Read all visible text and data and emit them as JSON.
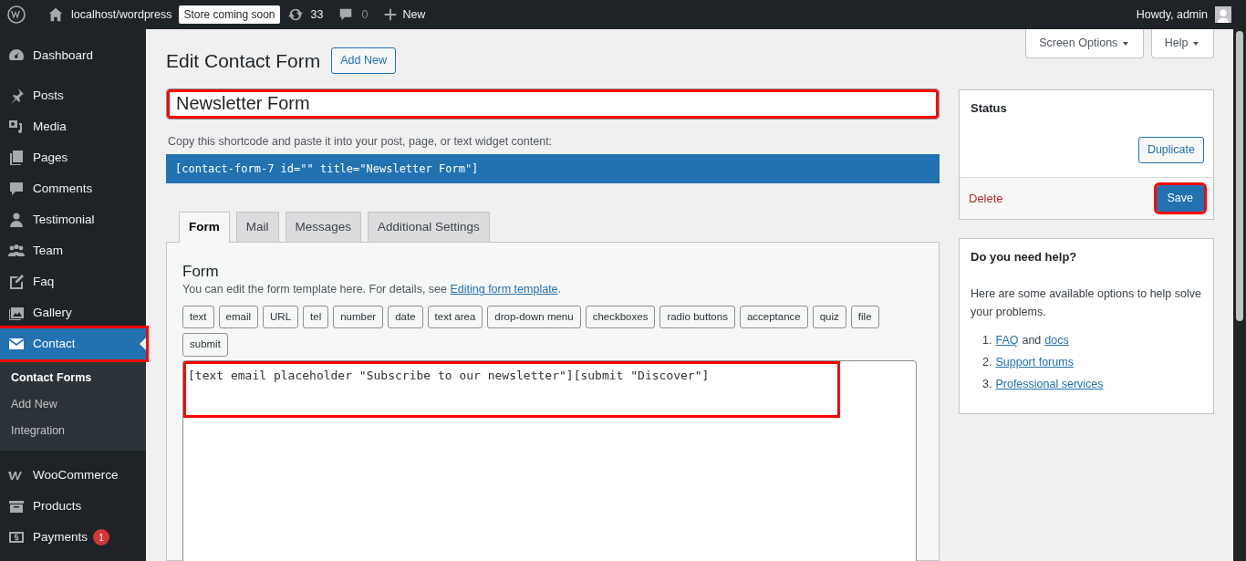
{
  "admin_bar": {
    "site": "localhost/wordpress",
    "store_badge": "Store coming soon",
    "updates": "33",
    "comments": "0",
    "new": "New",
    "greeting": "Howdy, admin"
  },
  "sidebar": {
    "items": [
      {
        "label": "Dashboard",
        "selected": false
      },
      {
        "label": "Posts",
        "selected": false
      },
      {
        "label": "Media",
        "selected": false
      },
      {
        "label": "Pages",
        "selected": false
      },
      {
        "label": "Comments",
        "selected": false
      },
      {
        "label": "Testimonial",
        "selected": false
      },
      {
        "label": "Team",
        "selected": false
      },
      {
        "label": "Faq",
        "selected": false
      },
      {
        "label": "Gallery",
        "selected": false
      },
      {
        "label": "Contact",
        "selected": true,
        "highlighted": true,
        "children": [
          {
            "label": "Contact Forms",
            "selected": true
          },
          {
            "label": "Add New",
            "selected": false
          },
          {
            "label": "Integration",
            "selected": false
          }
        ]
      },
      {
        "label": "WooCommerce",
        "selected": false
      },
      {
        "label": "Products",
        "selected": false
      },
      {
        "label": "Payments",
        "selected": false,
        "badge": "1"
      }
    ]
  },
  "screen_options": [
    "Screen Options",
    "Help"
  ],
  "page": {
    "title": "Edit Contact Form",
    "add_new": "Add New",
    "form_title": {
      "value": "Newsletter Form",
      "highlighted": true
    },
    "shortcode_label": "Copy this shortcode and paste it into your post, page, or text widget content:",
    "shortcode": "[contact-form-7 id=\"\" title=\"Newsletter Form\"]"
  },
  "tabs": [
    {
      "label": "Form",
      "selected": true
    },
    {
      "label": "Mail",
      "selected": false
    },
    {
      "label": "Messages",
      "selected": false
    },
    {
      "label": "Additional Settings",
      "selected": false
    }
  ],
  "form_panel": {
    "heading": "Form",
    "description": "You can edit the form template here. For details, see ",
    "description_link": "Editing form template",
    "description_end": ".",
    "tag_buttons": [
      "text",
      "email",
      "URL",
      "tel",
      "number",
      "date",
      "text area",
      "drop-down menu",
      "checkboxes",
      "radio buttons",
      "acceptance",
      "quiz",
      "file",
      "submit"
    ],
    "template": {
      "value": "[text email placeholder \"Subscribe to our newsletter\"][submit \"Discover\"]",
      "highlighted": true
    }
  },
  "status_box": {
    "title": "Status",
    "duplicate": "Duplicate",
    "delete": "Delete",
    "save": {
      "label": "Save",
      "highlighted": true
    }
  },
  "help_box": {
    "title": "Do you need help?",
    "text": "Here are some available options to help solve your problems.",
    "items": [
      {
        "number": "1.",
        "links": [
          "FAQ",
          "docs"
        ],
        "joiner": "and"
      },
      {
        "number": "2.",
        "links": [
          "Support forums"
        ]
      },
      {
        "number": "3.",
        "links": [
          "Professional services"
        ]
      }
    ]
  }
}
